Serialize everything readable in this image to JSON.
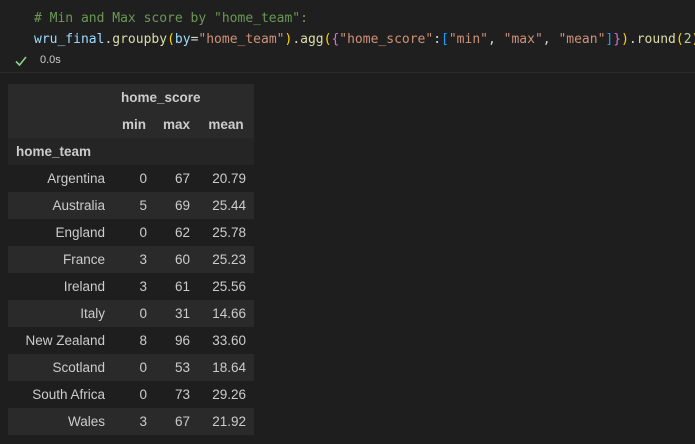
{
  "code": {
    "line1": "# Min and Max score by \"home_team\":",
    "line2": {
      "ident": "wru_final",
      "dot1": ".",
      "func1": "groupby",
      "paren_open": "(",
      "kw": "by",
      "eq": "=",
      "by_str": "\"home_team\"",
      "paren_close": ")",
      "dot2": ".",
      "func2": "agg",
      "paren_open2": "(",
      "brace_open": "{",
      "key_str": "\"home_score\"",
      "colon": ":",
      "brack_open": "[",
      "s_min": "\"min\"",
      "comma1": ", ",
      "s_max": "\"max\"",
      "comma2": ", ",
      "s_mean": "\"mean\"",
      "brack_close": "]",
      "brace_close": "}",
      "paren_close2": ")",
      "dot3": ".",
      "func3": "round",
      "paren_open3": "(",
      "num": "2",
      "paren_close3": ")"
    }
  },
  "status": {
    "exec_time": "0.0s",
    "icon": "check-icon",
    "icon_color": "#89d185"
  },
  "table": {
    "group_header": "home_score",
    "columns": [
      "min",
      "max",
      "mean"
    ],
    "index_name": "home_team",
    "rows": [
      {
        "team": "Argentina",
        "min": "0",
        "max": "67",
        "mean": "20.79"
      },
      {
        "team": "Australia",
        "min": "5",
        "max": "69",
        "mean": "25.44"
      },
      {
        "team": "England",
        "min": "0",
        "max": "62",
        "mean": "25.78"
      },
      {
        "team": "France",
        "min": "3",
        "max": "60",
        "mean": "25.23"
      },
      {
        "team": "Ireland",
        "min": "3",
        "max": "61",
        "mean": "25.56"
      },
      {
        "team": "Italy",
        "min": "0",
        "max": "31",
        "mean": "14.66"
      },
      {
        "team": "New Zealand",
        "min": "8",
        "max": "96",
        "mean": "33.60"
      },
      {
        "team": "Scotland",
        "min": "0",
        "max": "53",
        "mean": "18.64"
      },
      {
        "team": "South Africa",
        "min": "0",
        "max": "73",
        "mean": "29.26"
      },
      {
        "team": "Wales",
        "min": "3",
        "max": "67",
        "mean": "21.92"
      }
    ]
  }
}
